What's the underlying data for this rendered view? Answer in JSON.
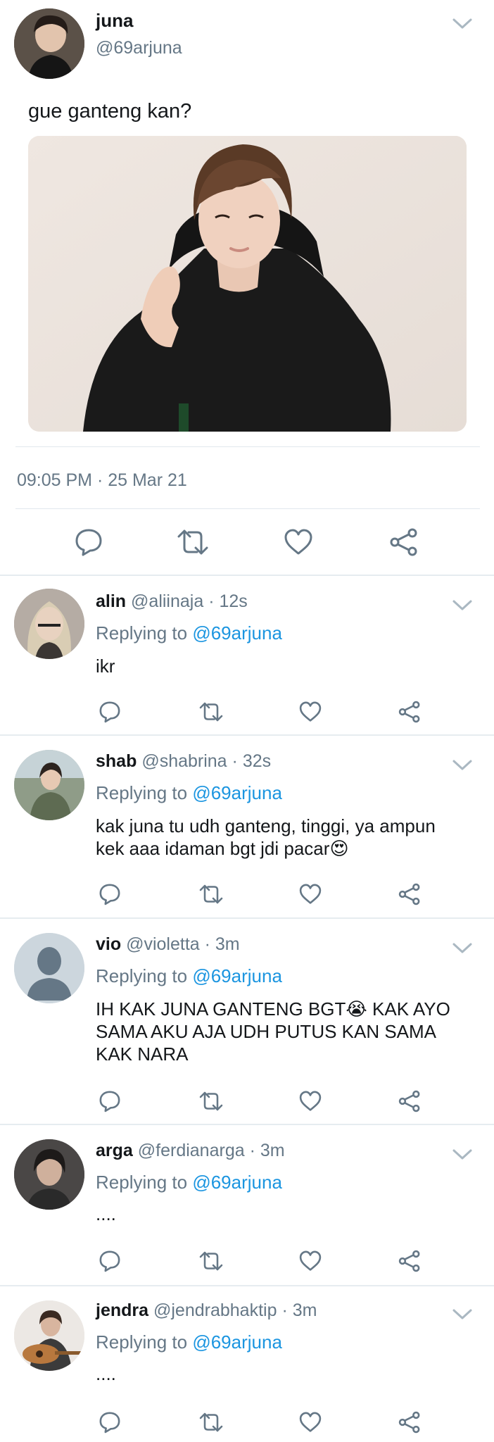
{
  "main_tweet": {
    "display_name": "juna",
    "handle": "@69arjuna",
    "text": "gue ganteng kan?",
    "timestamp": "09:05 PM · 25 Mar 21",
    "actions": [
      "reply-icon",
      "retweet-icon",
      "like-icon",
      "share-icon"
    ]
  },
  "replies": [
    {
      "name": "alin",
      "handle": "@aliinaja",
      "sep": "·",
      "time": "12s",
      "replying_label": "Replying to",
      "replying_handle": "@69arjuna",
      "text": "ikr"
    },
    {
      "name": "shab",
      "handle": "@shabrina",
      "sep": "·",
      "time": "32s",
      "replying_label": "Replying to",
      "replying_handle": "@69arjuna",
      "text_lines": [
        "kak juna tu udh ganteng, tinggi, ya ampun",
        "kek aaa idaman bgt jdi pacar"
      ],
      "emoji": "😍"
    },
    {
      "name": "vio",
      "handle": "@violetta",
      "sep": "·",
      "time": "3m",
      "replying_label": "Replying to",
      "replying_handle": "@69arjuna",
      "text_lines": [
        "IH KAK JUNA GANTENG BGT",
        "SAMA AKU AJA UDH PUTUS KAN SAMA",
        "KAK NARA"
      ],
      "line1_suffix": " KAK AYO",
      "emoji": "😭"
    },
    {
      "name": "arga",
      "handle": "@ferdianarga",
      "sep": "·",
      "time": "3m",
      "replying_label": "Replying to",
      "replying_handle": "@69arjuna",
      "text": "...."
    },
    {
      "name": "jendra",
      "handle": "@jendrabhaktip",
      "sep": "·",
      "time": "3m",
      "replying_label": "Replying to",
      "replying_handle": "@69arjuna",
      "text": "...."
    }
  ],
  "colors": {
    "text": "#14171a",
    "secondary": "#657786",
    "link": "#1b95e0",
    "divider": "#e1e8ed",
    "icon": "#657786"
  }
}
